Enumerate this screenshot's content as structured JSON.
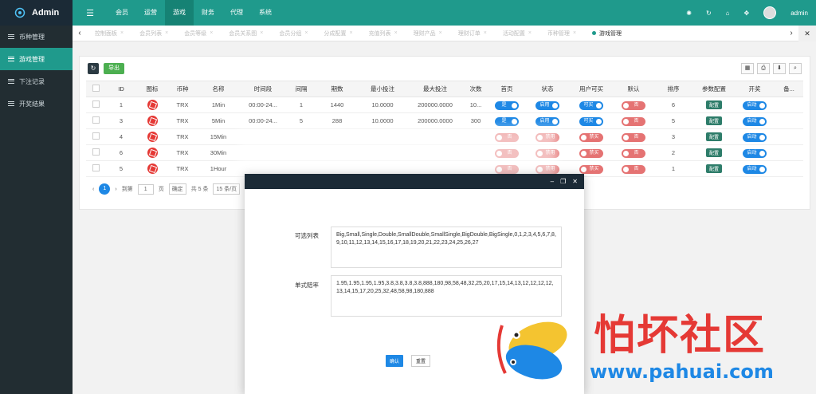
{
  "app": {
    "title": "Admin"
  },
  "topnav": {
    "items": [
      "会员",
      "运营",
      "游戏",
      "财务",
      "代理",
      "系统"
    ],
    "active_index": 2
  },
  "user": {
    "name": "admin"
  },
  "sidebar": {
    "items": [
      "币种管理",
      "游戏管理",
      "下注记录",
      "开奖结果"
    ],
    "active_index": 1
  },
  "tabs": {
    "items": [
      "控制面板",
      "会员列表",
      "会员等级",
      "会员关系图",
      "会员分组",
      "分成配置",
      "充值列表",
      "理财产品",
      "理财订单",
      "活动配置",
      "币种管理",
      "游戏管理"
    ],
    "active_index": 11
  },
  "toolbar": {
    "refresh_icon": "refresh-icon",
    "export_label": "导出"
  },
  "table": {
    "headers": [
      "",
      "ID",
      "图标",
      "币种",
      "名称",
      "时间段",
      "间隔",
      "期数",
      "最小投注",
      "最大投注",
      "次数",
      "首页",
      "状态",
      "用户可买",
      "默认",
      "排序",
      "参数配置",
      "开奖",
      "备..."
    ],
    "rows": [
      {
        "id": "1",
        "coin": "TRX",
        "name": "1Min",
        "period": "00:00-24...",
        "interval": "1",
        "issues": "1440",
        "min": "10.0000",
        "max": "200000.0000",
        "times": "10...",
        "home": "是",
        "status": "启用",
        "buy": "可买",
        "default": "否",
        "sort": "6",
        "cfg": "配置",
        "draw": "启动"
      },
      {
        "id": "3",
        "coin": "TRX",
        "name": "5Min",
        "period": "00:00-24...",
        "interval": "5",
        "issues": "288",
        "min": "10.0000",
        "max": "200000.0000",
        "times": "300",
        "home": "是",
        "status": "启用",
        "buy": "可买",
        "default": "否",
        "sort": "5",
        "cfg": "配置",
        "draw": "启动"
      },
      {
        "id": "4",
        "coin": "TRX",
        "name": "15Min",
        "period": "",
        "interval": "",
        "issues": "",
        "min": "",
        "max": "",
        "times": "",
        "home": "否",
        "status": "禁用",
        "buy": "禁买",
        "default": "否",
        "sort": "3",
        "cfg": "配置",
        "draw": "启动"
      },
      {
        "id": "6",
        "coin": "TRX",
        "name": "30Min",
        "period": "",
        "interval": "",
        "issues": "",
        "min": "",
        "max": "",
        "times": "",
        "home": "否",
        "status": "禁用",
        "buy": "禁买",
        "default": "否",
        "sort": "2",
        "cfg": "配置",
        "draw": "启动"
      },
      {
        "id": "5",
        "coin": "TRX",
        "name": "1Hour",
        "period": "",
        "interval": "",
        "issues": "",
        "min": "",
        "max": "",
        "times": "",
        "home": "否",
        "status": "禁用",
        "buy": "禁买",
        "default": "否",
        "sort": "1",
        "cfg": "配置",
        "draw": "启动"
      }
    ]
  },
  "pager": {
    "current": "1",
    "goto_label": "到第",
    "page_input": "1",
    "page_unit": "页",
    "confirm": "确定",
    "total": "共 5 条",
    "per_page": "15 条/页"
  },
  "modal": {
    "field1_label": "可选列表",
    "field1_value": "Big,Small,Single,Double,SmallDouble,SmallSingle,BigDouble,BigSingle,0,1,2,3,4,5,6,7,8,9,10,11,12,13,14,15,16,17,18,19,20,21,22,23,24,25,26,27",
    "field2_label": "单式赔率",
    "field2_value": "1.95,1.95,1.95,1.95,3.8,3.8,3.8,3.8,888,180,98,58,48,32,25,20,17,15,14,13,12,12,12,12,13,14,15,17,20,25,32,48,58,98,180,888",
    "ok_label": "确认",
    "reset_label": "重置"
  },
  "watermark": {
    "title": "怕坏社区",
    "url": "www.pahuai.com"
  }
}
